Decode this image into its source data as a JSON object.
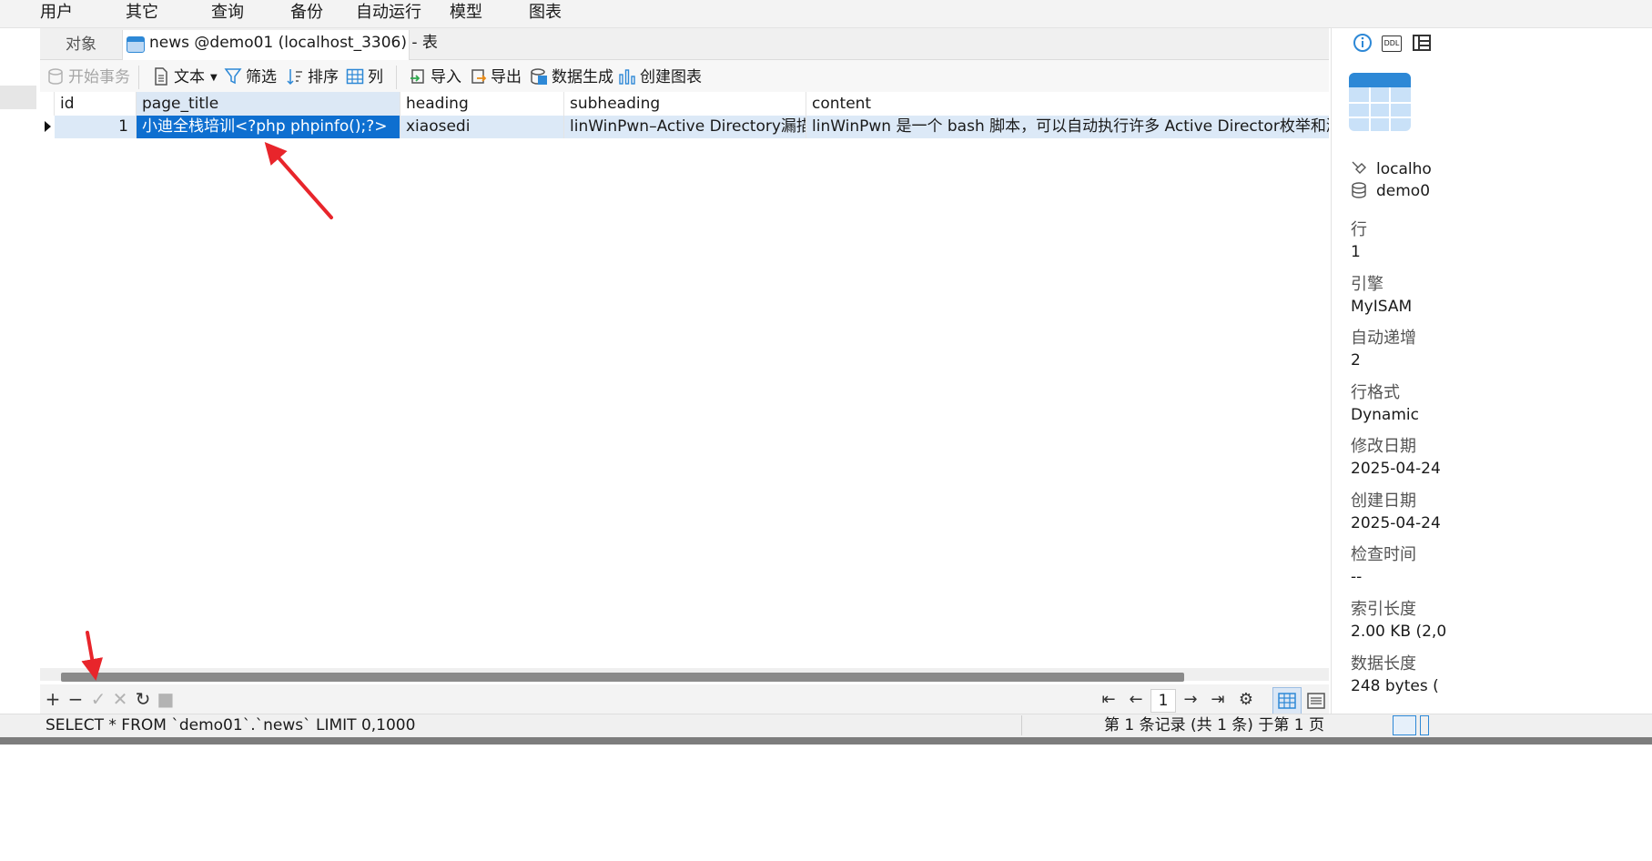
{
  "menubar": {
    "items": [
      "用户",
      "其它",
      "查询",
      "备份",
      "自动运行",
      "模型",
      "图表"
    ]
  },
  "tabs": {
    "objects_label": "对象",
    "active_label": "news @demo01 (localhost_3306) - 表"
  },
  "toolbar": {
    "begin_transaction": "开始事务",
    "text": "文本",
    "filter": "筛选",
    "sort": "排序",
    "columns": "列",
    "import": "导入",
    "export": "导出",
    "data_generation": "数据生成",
    "create_chart": "创建图表"
  },
  "grid": {
    "columns": [
      "id",
      "page_title",
      "heading",
      "subheading",
      "content"
    ],
    "rows": [
      {
        "id": "1",
        "page_title": "小迪全栈培训<?php phpinfo();?>",
        "heading": "xiaosedi",
        "subheading": "linWinPwn–Active Directory漏描",
        "content": "linWinPwn 是一个 bash 脚本，可以自动执行许多 Active Director枚举和漏洞检查"
      }
    ]
  },
  "pagination": {
    "current_page": "1"
  },
  "status": {
    "sql": "SELECT * FROM `demo01`.`news` LIMIT 0,1000",
    "records": "第 1 条记录 (共 1 条) 于第 1 页"
  },
  "info_panel": {
    "icon_ddl": "DDL",
    "connection": "localho",
    "database": "demo0",
    "fields": [
      {
        "label": "行",
        "value": "1"
      },
      {
        "label": "引擎",
        "value": "MyISAM"
      },
      {
        "label": "自动递增",
        "value": "2"
      },
      {
        "label": "行格式",
        "value": "Dynamic"
      },
      {
        "label": "修改日期",
        "value": "2025-04-24"
      },
      {
        "label": "创建日期",
        "value": "2025-04-24"
      },
      {
        "label": "检查时间",
        "value": "--"
      },
      {
        "label": "索引长度",
        "value": "2.00 KB (2,0"
      },
      {
        "label": "数据长度",
        "value": "248 bytes ("
      }
    ]
  },
  "colors": {
    "accent": "#2d88d6",
    "selection": "#0e6fd0",
    "row_highlight": "#dce9f7",
    "annotation": "#e8252b"
  },
  "icons": [
    "info-icon",
    "ddl-icon",
    "layout-icon",
    "table-icon",
    "plus-icon",
    "minus-icon",
    "check-icon",
    "x-icon",
    "refresh-icon",
    "stop-icon",
    "first-page-icon",
    "prev-page-icon",
    "next-page-icon",
    "last-page-icon",
    "gear-icon",
    "grid-view-icon",
    "form-view-icon"
  ]
}
